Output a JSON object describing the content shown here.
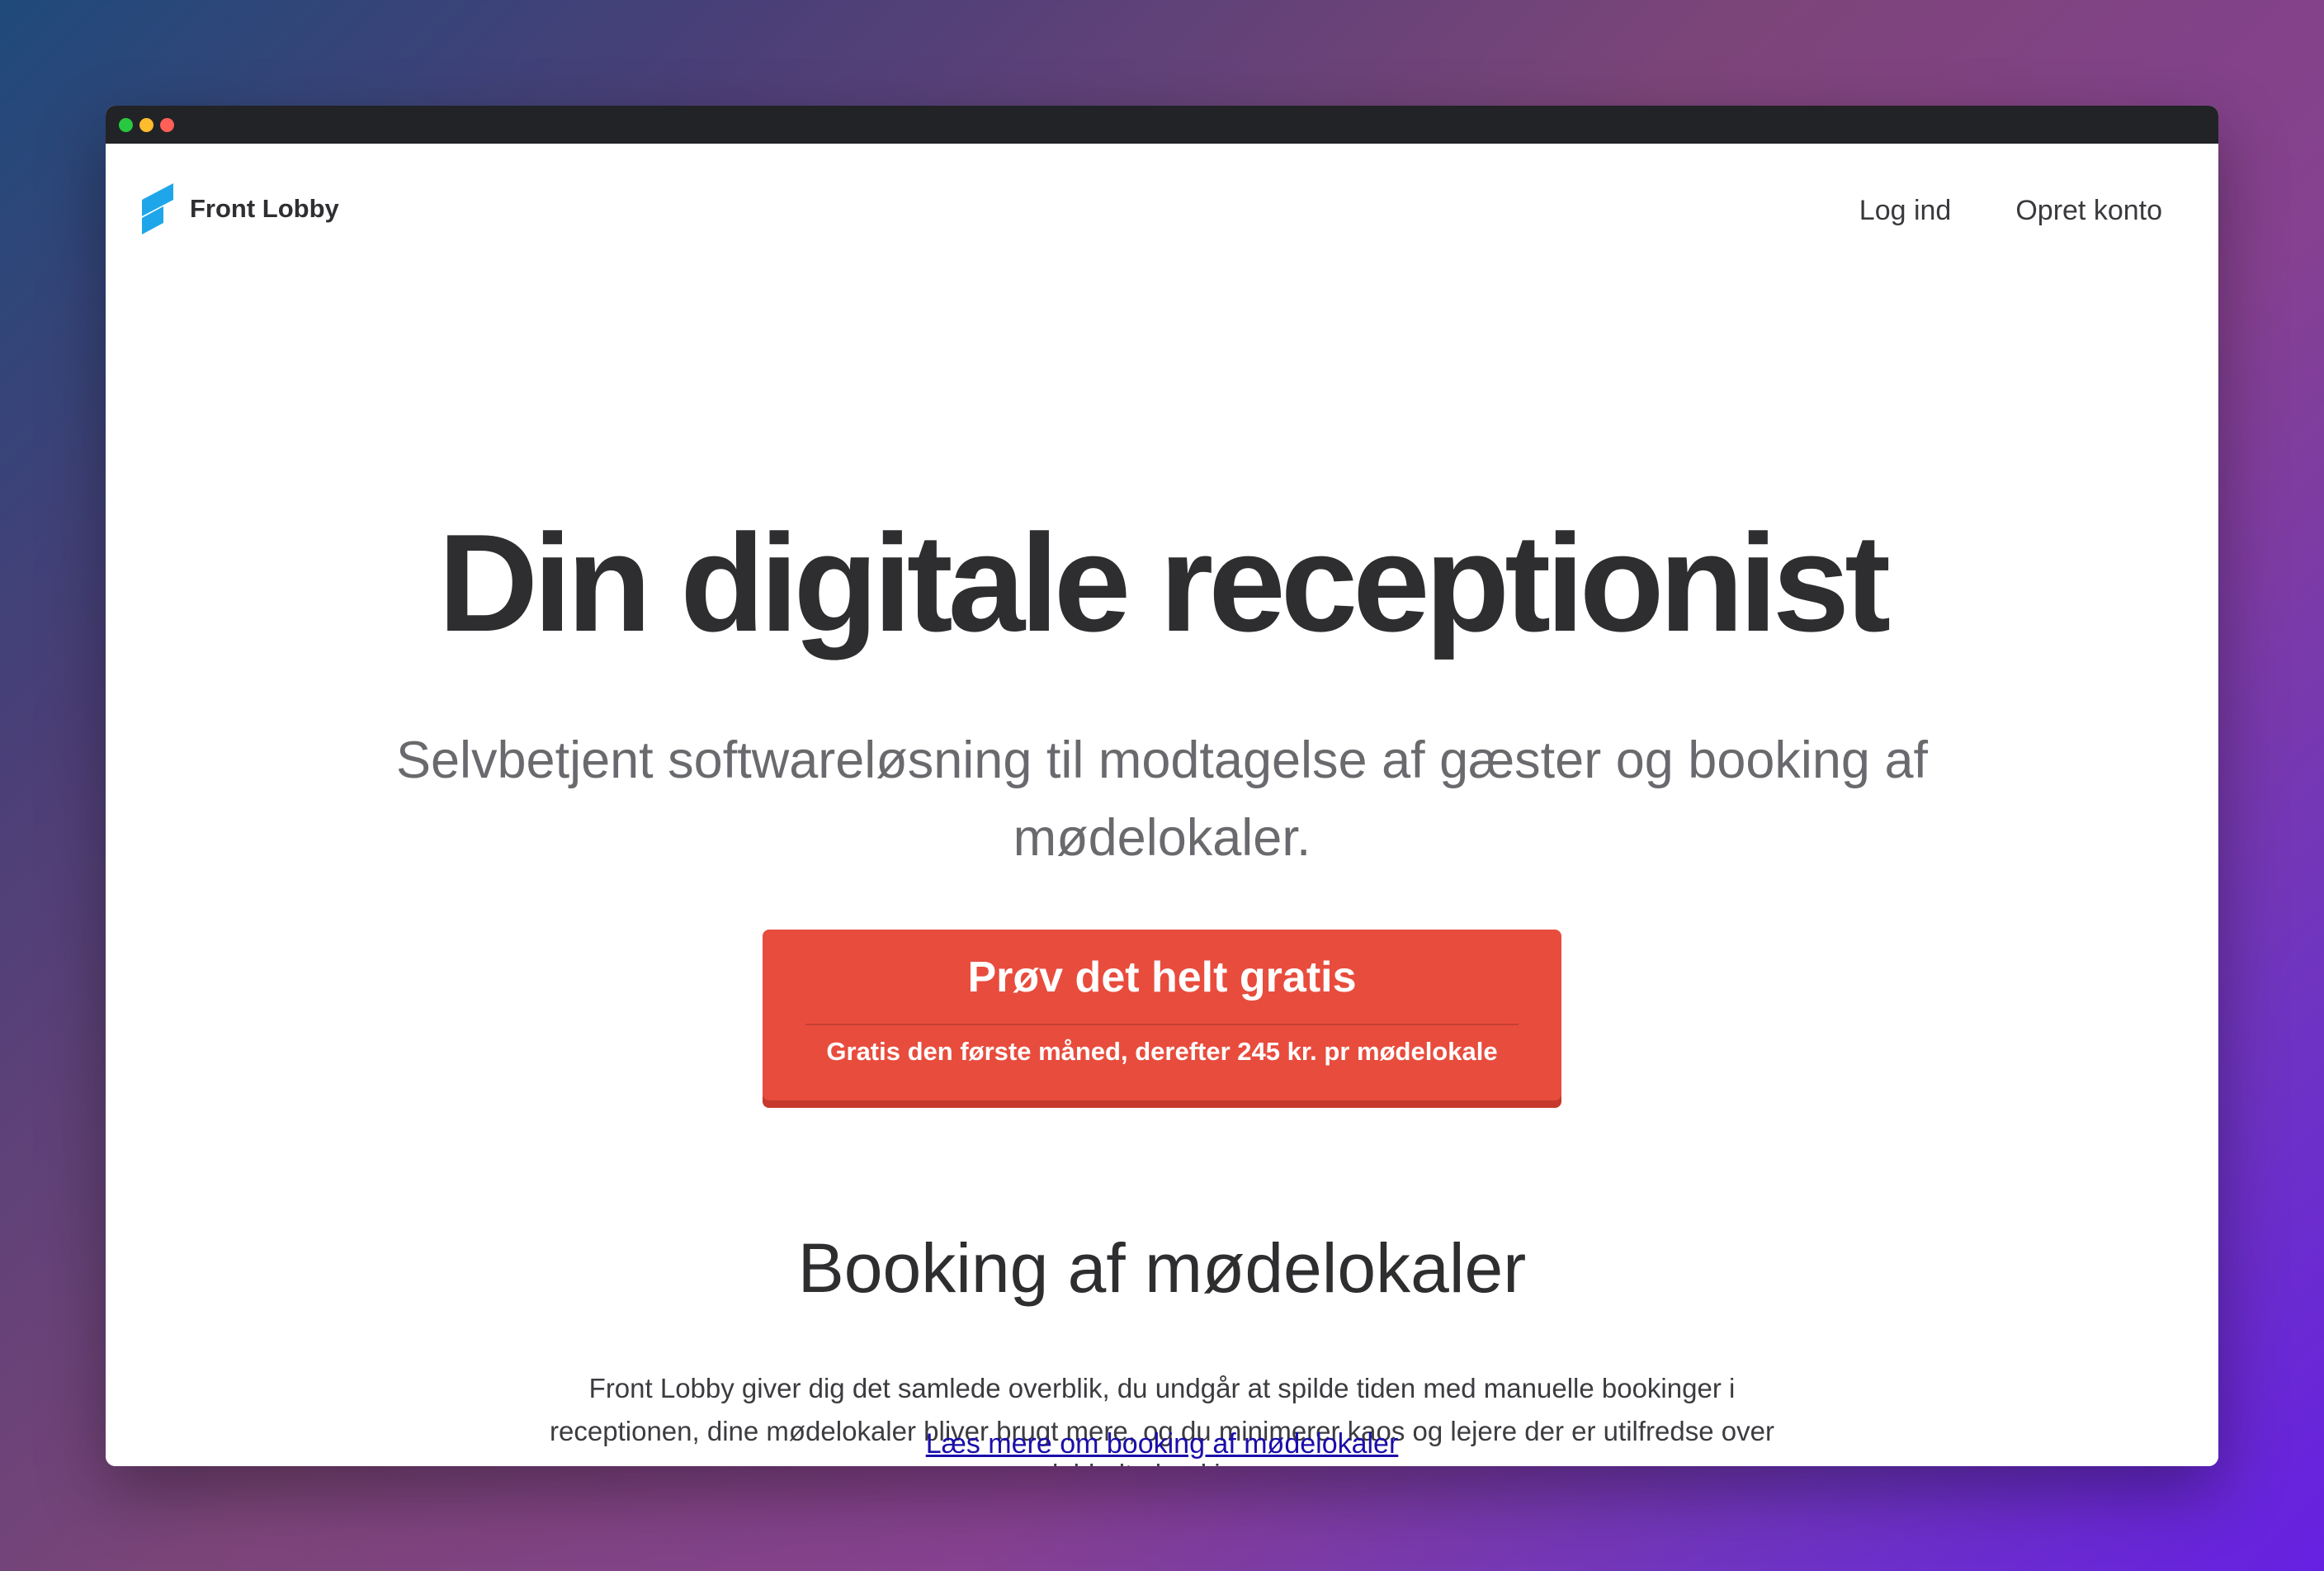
{
  "colors": {
    "traffic_green": "#28c840",
    "traffic_yellow": "#febc2e",
    "traffic_red": "#ff5f57",
    "logo_blue": "#1fa6ea",
    "cta": "#e84c3d"
  },
  "header": {
    "logo_icon": "front-lobby-logo-icon",
    "logo_text": "Front Lobby",
    "nav": {
      "login": "Log ind",
      "signup": "Opret konto"
    }
  },
  "hero": {
    "title": "Din digitale receptionist",
    "subtitle": "Selvbetjent softwareløsning til modtagelse af gæster og booking af mødelokaler."
  },
  "cta": {
    "label": "Prøv det helt gratis",
    "sublabel": "Gratis den første måned, derefter 245 kr. pr mødelokale"
  },
  "section": {
    "heading": "Booking af mødelokaler",
    "body": "Front Lobby giver dig det samlede overblik, du undgår at spilde tiden med manuelle bookinger i receptionen, dine mødelokaler bliver brugt mere, og du minimerer kaos og lejere der er utilfredse over dobbelte bookinger.",
    "link": "Læs mere om booking af mødelokaler"
  }
}
